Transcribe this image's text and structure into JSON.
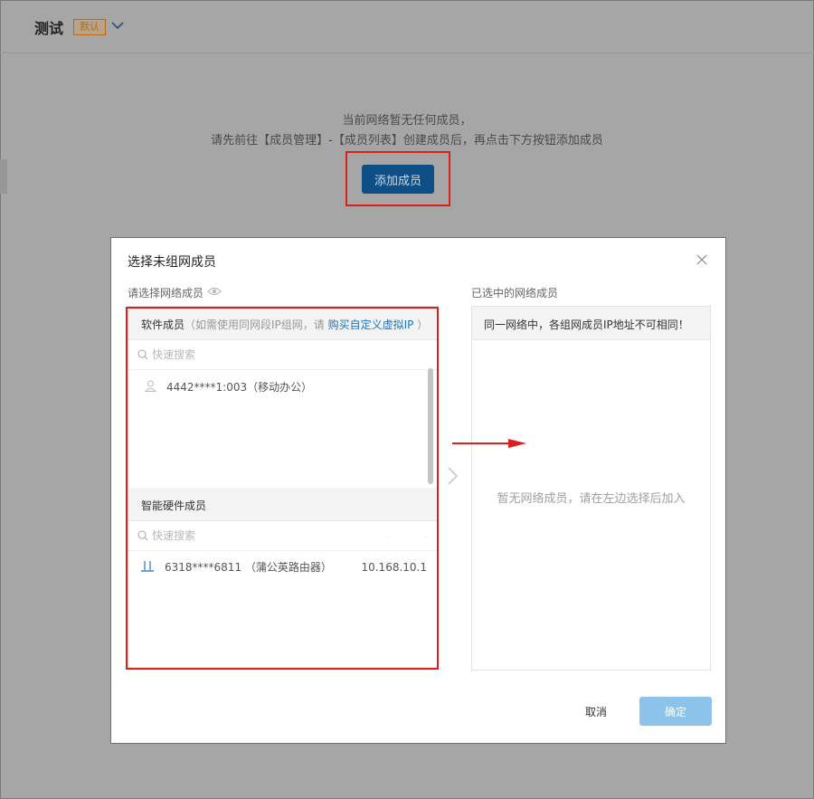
{
  "page": {
    "title": "测试",
    "default_badge": "默认",
    "empty_line1": "当前网络暂无任何成员，",
    "empty_line2": "请先前往【成员管理】-【成员列表】创建成员后，再点击下方按钮添加成员",
    "add_button": "添加成员"
  },
  "dialog": {
    "title": "选择未组网成员",
    "left_label": "请选择网络成员",
    "right_label": "已选中的网络成员",
    "software": {
      "title": "软件成员",
      "hint_prefix": "（如需使用同网段IP组网，请 ",
      "hint_link": "购买自定义虚拟IP",
      "hint_suffix": " ）",
      "search_placeholder": "快速搜索",
      "members": [
        {
          "name": "4442****1:003（移动办公）"
        }
      ]
    },
    "hardware": {
      "title": "智能硬件成员",
      "search_placeholder": "快速搜索",
      "members": [
        {
          "name": "6318****6811 （蒲公英路由器）",
          "ip": "10.168.10.1"
        }
      ]
    },
    "right_notice": "同一网络中，各组网成员IP地址不可相同！",
    "right_empty": "暂无网络成员，请在左边选择后加入",
    "cancel": "取消",
    "confirm": "确定"
  },
  "colors": {
    "accent": "#1a73c6",
    "annotation": "#e01d1d",
    "confirm_disabled": "#8cc3ea",
    "add_button": "#0e4f86"
  }
}
